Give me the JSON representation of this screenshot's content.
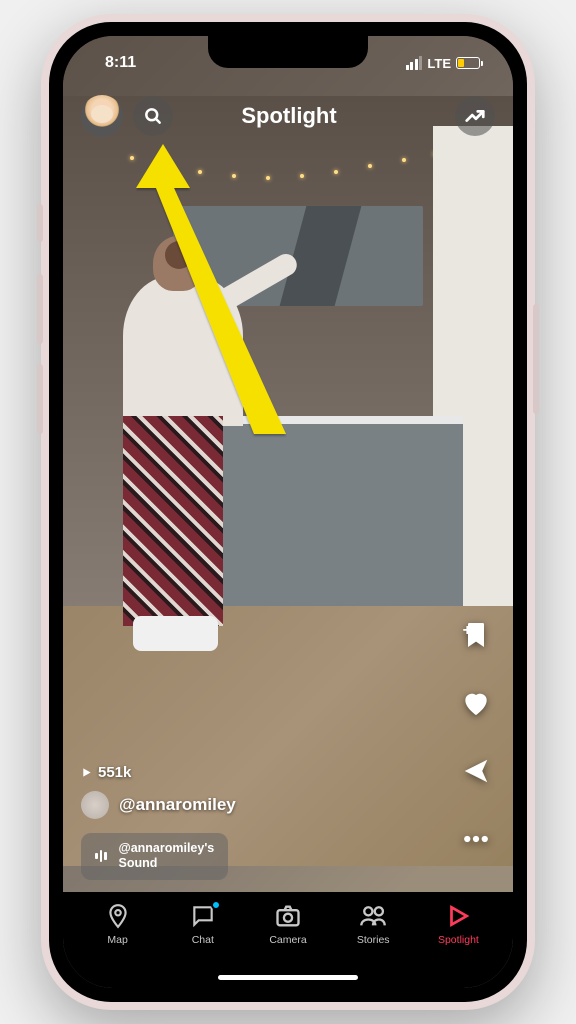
{
  "status": {
    "time": "8:11",
    "network": "LTE"
  },
  "header": {
    "title": "Spotlight"
  },
  "video": {
    "play_count": "551k",
    "creator_handle": "@annaromiley",
    "sound_label_line1": "@annaromiley's",
    "sound_label_line2": "Sound"
  },
  "nav": {
    "map": "Map",
    "chat": "Chat",
    "camera": "Camera",
    "stories": "Stories",
    "spotlight": "Spotlight"
  },
  "icons": {
    "avatar": "profile-avatar",
    "search": "search-icon",
    "trending": "trending-up-icon",
    "bookmark": "bookmark-add-icon",
    "heart": "heart-icon",
    "share": "share-icon",
    "more": "more-icon"
  },
  "colors": {
    "active_nav": "#ff3b5c",
    "badge": "#00bfff",
    "annotation_arrow": "#f5e000",
    "battery_low": "#ffcc00"
  }
}
